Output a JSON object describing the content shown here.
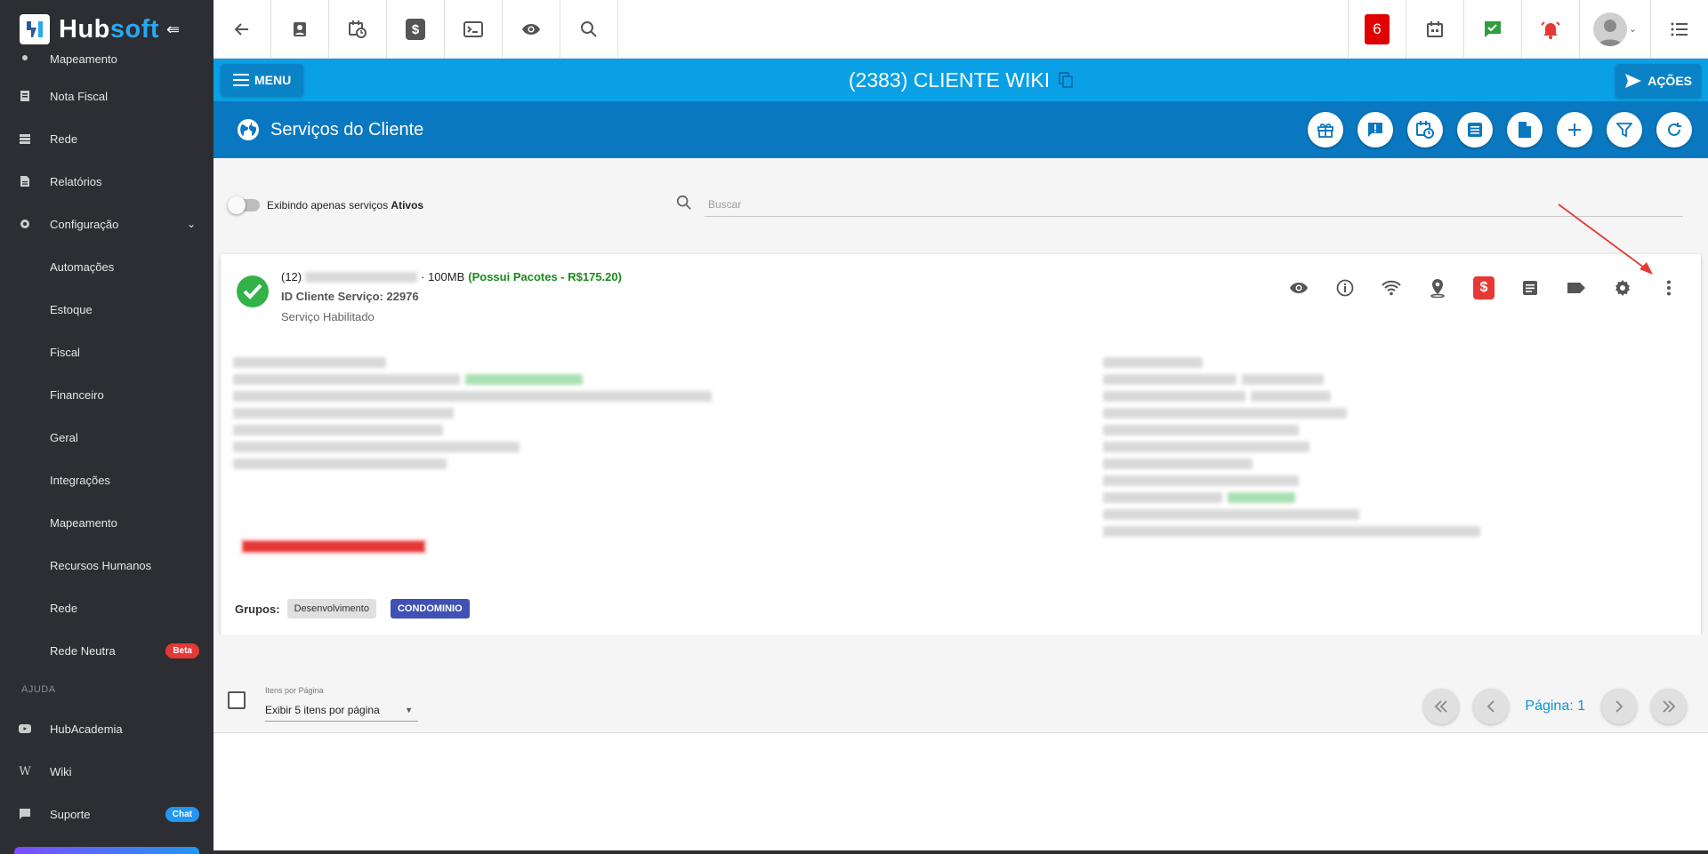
{
  "brand": {
    "name_part1": "Hub",
    "name_part2": "soft"
  },
  "sidebar": {
    "partial_item": "Mapeamento",
    "items": [
      {
        "label": "Nota Fiscal",
        "icon": "document-icon"
      },
      {
        "label": "Rede",
        "icon": "server-icon"
      },
      {
        "label": "Relatórios",
        "icon": "report-icon"
      },
      {
        "label": "Configuração",
        "icon": "gear-icon"
      }
    ],
    "config_sub": [
      "Automações",
      "Estoque",
      "Fiscal",
      "Financeiro",
      "Geral",
      "Integrações",
      "Mapeamento",
      "Recursos Humanos",
      "Rede",
      "Rede Neutra"
    ],
    "beta_badge": "Beta",
    "help_section": "AJUDA",
    "help_items": [
      {
        "label": "HubAcademia",
        "icon": "youtube-icon"
      },
      {
        "label": "Wiki",
        "icon": "wiki-icon"
      },
      {
        "label": "Suporte",
        "icon": "chat-icon"
      }
    ],
    "chat_badge": "Chat"
  },
  "topbar": {
    "notification_count": "6"
  },
  "client_bar": {
    "menu_label": "MENU",
    "client_title": "(2383) CLIENTE WIKI",
    "actions_label": "AÇÕES"
  },
  "services": {
    "title": "Serviços do Cliente"
  },
  "filter": {
    "toggle_text": "Exibindo apenas serviços ",
    "toggle_bold": "Ativos",
    "search_placeholder": "Buscar"
  },
  "service_card": {
    "prefix": "(12)",
    "speed": "· 100MB",
    "package": "(Possui Pacotes - R$175.20)",
    "id_line": "ID Cliente Serviço: 22976",
    "status": "Serviço Habilitado",
    "groups_label": "Grupos:",
    "groups": [
      "Desenvolvimento",
      "CONDOMINIO"
    ]
  },
  "pagination": {
    "items_label": "Itens por Página",
    "items_value": "Exibir 5 itens por página",
    "page_label": "Página: 1"
  },
  "colors": {
    "sidebar_bg": "#2c2e33",
    "header_blue": "#0aa0e6",
    "services_blue": "#0a78c0",
    "success_green": "#33b24a",
    "danger_red": "#e53935",
    "group_blue": "#3f51b5"
  }
}
